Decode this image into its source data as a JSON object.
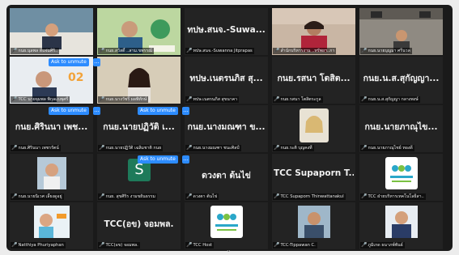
{
  "meeting": {
    "participants": [
      {
        "caption": "กนย.นุลพล ดีแจ่มศิริ..",
        "speaking": true
      },
      {
        "caption": "กนย.สวัสดิ์ ..สาม.ขพรรณ์"
      },
      {
        "display": "ทปษ.สนจ.-Suwa...",
        "caption": "ทปษ.สนจ.-Suwanna Jitprapas"
      },
      {
        "caption": "สำนักบริหารงาน ..ทรัพยฯ..กา"
      },
      {
        "caption": "กนย.นายบุญมา ศรีนวล"
      },
      {
        "caption": "TCC นายจุมพล พิกุลแบพุศรี"
      },
      {
        "caption": "กนย.นางวัชรี ผลพิทักษ์"
      },
      {
        "display": "ทปษ.เนตรนภิส สุ...",
        "caption": "ทปษ.เนตรนภิส สุขนาคา"
      },
      {
        "display": "กนย.รสนา โตสิต...",
        "caption": "กนย.รสนา โตสิตระกูล"
      },
      {
        "display": "กนย.น.ส.สุกัญญา...",
        "caption": "กนย.น.ส.สุกัญญา กลางพงษ์"
      },
      {
        "display": "กนย.ศิรินนา เพช...",
        "caption": "กนย.ศิรินนา เพชรรัตน์"
      },
      {
        "display": "กนย.นายปฏิวัติ เ...",
        "caption": "กนย.นายปฏิวัติ เฉลิมชาติ กนย"
      },
      {
        "display": "กนย.นางมณฑา ข...",
        "caption": "กนย.นางมณฑา ชนะศิลป์"
      },
      {
        "caption": "กนย.ระติ บุญคงที่"
      },
      {
        "display": "กนย.นายภาณุไข...",
        "caption": "กนย.นายภาณุไชย์ ทองดี"
      },
      {
        "caption": "กนย.นายนิเวศ เลี้ยงดูอยู่"
      },
      {
        "avatar_letter": "S",
        "caption": "กนย. สุขศิริร งามขยันธรรม"
      },
      {
        "display": "ดวงตา ต้นไข่",
        "caption": "ดวงตา ต้นไข่"
      },
      {
        "display": "TCC Supaporn T...",
        "caption": "TCC Supaporn Thinwattanakul"
      },
      {
        "logo": "tcc",
        "caption": "TCC ฝ่ายบริหารเทคโนโลยีสา.."
      },
      {
        "caption": "Natthiya Phuriyaphan"
      },
      {
        "display": "TCC(อข) จอมพล.",
        "caption": "TCC(อข) จอมพล."
      },
      {
        "logo": "tcc",
        "caption": "TCC Host"
      },
      {
        "caption": "TCC-Tippawan C."
      },
      {
        "caption": "ภูมิเกด ธนาภพ์พันธ์"
      }
    ],
    "unmute_label": "Ask to unmute",
    "more_label": "...",
    "pager_icon": "chevron-down-icon",
    "pager_glyph": "⌄",
    "colors": {
      "speaking": "#2dd36b",
      "unmute": "#2d8cff",
      "muted_mic": "#e5484d"
    }
  }
}
